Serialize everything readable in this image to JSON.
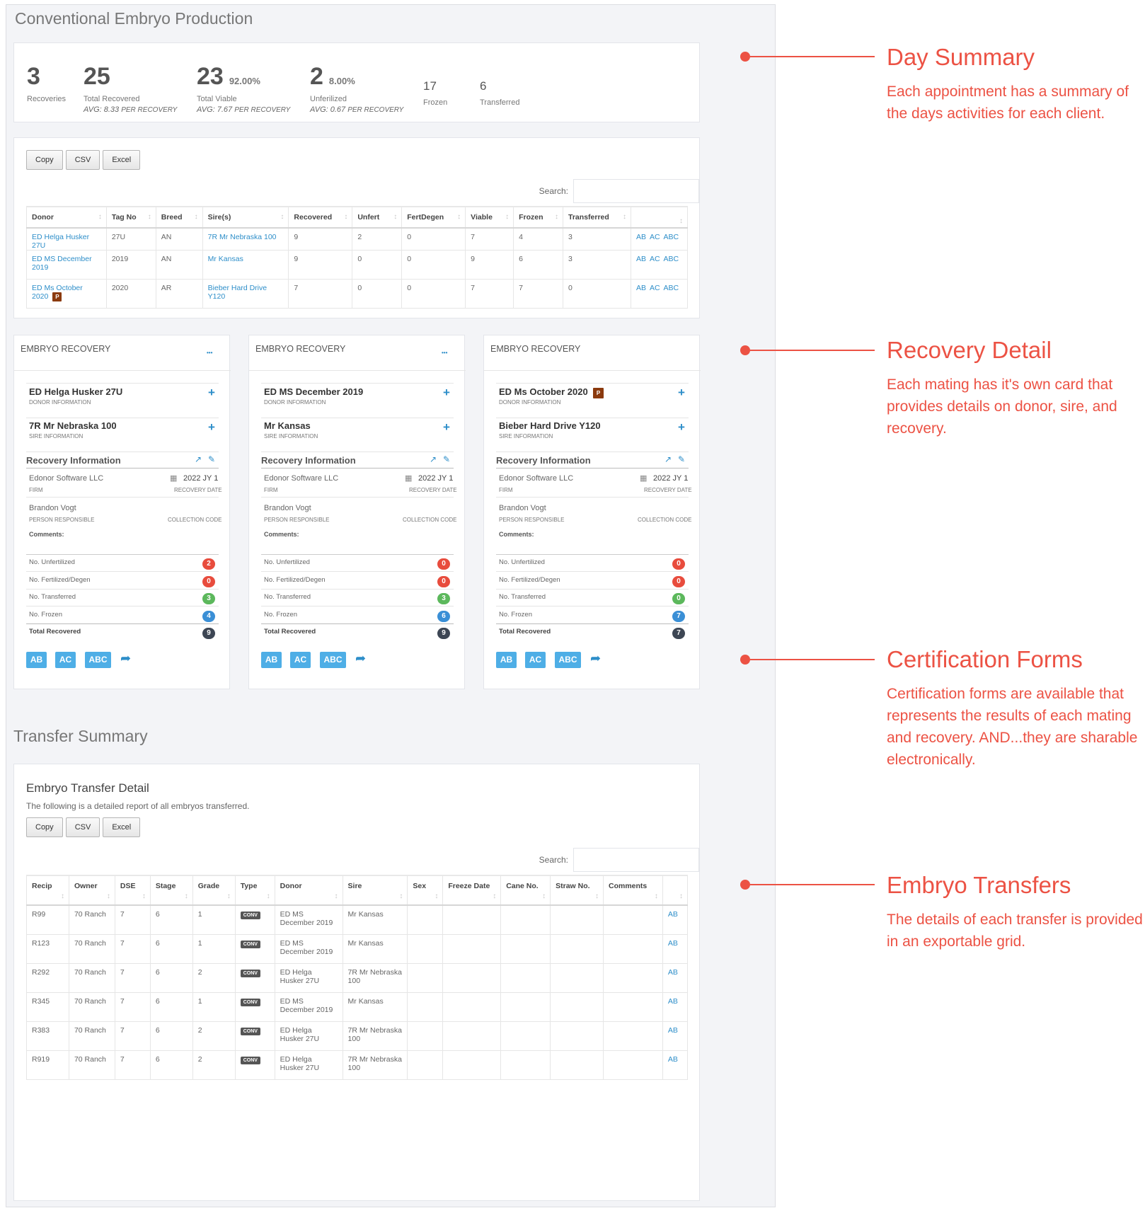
{
  "page_title": "Conventional Embryo Production",
  "summary": {
    "recoveries": {
      "value": "3",
      "label": "Recoveries"
    },
    "total_recovered": {
      "value": "25",
      "label": "Total Recovered",
      "avg": "AVG: 8.33",
      "avg_unit": "PER RECOVERY"
    },
    "total_viable": {
      "value": "23",
      "pct": "92.00%",
      "label": "Total Viable",
      "avg": "AVG: 7.67",
      "avg_unit": "PER RECOVERY"
    },
    "unfertilized": {
      "value": "2",
      "pct": "8.00%",
      "label": "Unferilized",
      "avg": "AVG: 0.67",
      "avg_unit": "PER RECOVERY"
    },
    "frozen": {
      "value": "17",
      "label": "Frozen"
    },
    "transferred": {
      "value": "6",
      "label": "Transferred"
    }
  },
  "export_buttons": {
    "copy": "Copy",
    "csv": "CSV",
    "excel": "Excel"
  },
  "search_label": "Search:",
  "donor_table": {
    "headers": [
      "Donor",
      "Tag No",
      "Breed",
      "Sire(s)",
      "Recovered",
      "Unfert",
      "FertDegen",
      "Viable",
      "Frozen",
      "Transferred",
      ""
    ],
    "rows": [
      {
        "donor": "ED Helga Husker 27U",
        "tag": "27U",
        "breed": "AN",
        "sire": "7R Mr Nebraska 100",
        "recovered": "9",
        "unfert": "2",
        "fertdegen": "0",
        "viable": "7",
        "frozen": "4",
        "transferred": "3",
        "certs": [
          "AB",
          "AC",
          "ABC"
        ],
        "flag": ""
      },
      {
        "donor": "ED MS December 2019",
        "tag": "2019",
        "breed": "AN",
        "sire": "Mr Kansas",
        "recovered": "9",
        "unfert": "0",
        "fertdegen": "0",
        "viable": "9",
        "frozen": "6",
        "transferred": "3",
        "certs": [
          "AB",
          "AC",
          "ABC"
        ],
        "flag": ""
      },
      {
        "donor": "ED Ms October 2020",
        "tag": "2020",
        "breed": "AR",
        "sire": "Bieber Hard Drive Y120",
        "recovered": "7",
        "unfert": "0",
        "fertdegen": "0",
        "viable": "7",
        "frozen": "7",
        "transferred": "0",
        "certs": [
          "AB",
          "AC",
          "ABC"
        ],
        "flag": "P"
      }
    ]
  },
  "recovery_cards": [
    {
      "header": "EMBRYO RECOVERY",
      "donor": "ED Helga Husker 27U",
      "donor_flag": "",
      "donor_sub": "DONOR INFORMATION",
      "sire": "7R Mr Nebraska 100",
      "sire_sub": "SIRE INFORMATION",
      "section": "Recovery Information",
      "firm": "Edonor Software LLC",
      "firm_label": "FIRM",
      "date": "2022 JY 1",
      "date_label": "RECOVERY DATE",
      "person": "Brandon Vogt",
      "person_label": "PERSON RESPONSIBLE",
      "code_label": "COLLECTION CODE",
      "comments_label": "Comments:",
      "stats": [
        {
          "label": "No. Unfertilized",
          "value": "2",
          "color": "#e84c3d"
        },
        {
          "label": "No. Fertilized/Degen",
          "value": "0",
          "color": "#e84c3d"
        },
        {
          "label": "No. Transferred",
          "value": "3",
          "color": "#5cb85c"
        },
        {
          "label": "No. Frozen",
          "value": "4",
          "color": "#3a8fd6"
        },
        {
          "label": "Total Recovered",
          "value": "9",
          "color": "#3d4654"
        }
      ],
      "certs": [
        "AB",
        "AC",
        "ABC"
      ],
      "has_menu": true
    },
    {
      "header": "EMBRYO RECOVERY",
      "donor": "ED MS December 2019",
      "donor_flag": "",
      "donor_sub": "DONOR INFORMATION",
      "sire": "Mr Kansas",
      "sire_sub": "SIRE INFORMATION",
      "section": "Recovery Information",
      "firm": "Edonor Software LLC",
      "firm_label": "FIRM",
      "date": "2022 JY 1",
      "date_label": "RECOVERY DATE",
      "person": "Brandon Vogt",
      "person_label": "PERSON RESPONSIBLE",
      "code_label": "COLLECTION CODE",
      "comments_label": "Comments:",
      "stats": [
        {
          "label": "No. Unfertilized",
          "value": "0",
          "color": "#e84c3d"
        },
        {
          "label": "No. Fertilized/Degen",
          "value": "0",
          "color": "#e84c3d"
        },
        {
          "label": "No. Transferred",
          "value": "3",
          "color": "#5cb85c"
        },
        {
          "label": "No. Frozen",
          "value": "6",
          "color": "#3a8fd6"
        },
        {
          "label": "Total Recovered",
          "value": "9",
          "color": "#3d4654"
        }
      ],
      "certs": [
        "AB",
        "AC",
        "ABC"
      ],
      "has_menu": true
    },
    {
      "header": "EMBRYO RECOVERY",
      "donor": "ED Ms October 2020",
      "donor_flag": "P",
      "donor_sub": "DONOR INFORMATION",
      "sire": "Bieber Hard Drive Y120",
      "sire_sub": "SIRE INFORMATION",
      "section": "Recovery Information",
      "firm": "Edonor Software LLC",
      "firm_label": "FIRM",
      "date": "2022 JY 1",
      "date_label": "RECOVERY DATE",
      "person": "Brandon Vogt",
      "person_label": "PERSON RESPONSIBLE",
      "code_label": "COLLECTION CODE",
      "comments_label": "Comments:",
      "stats": [
        {
          "label": "No. Unfertilized",
          "value": "0",
          "color": "#e84c3d"
        },
        {
          "label": "No. Fertilized/Degen",
          "value": "0",
          "color": "#e84c3d"
        },
        {
          "label": "No. Transferred",
          "value": "0",
          "color": "#5cb85c"
        },
        {
          "label": "No. Frozen",
          "value": "7",
          "color": "#3a8fd6"
        },
        {
          "label": "Total Recovered",
          "value": "7",
          "color": "#3d4654"
        }
      ],
      "certs": [
        "AB",
        "AC",
        "ABC"
      ],
      "has_menu": false
    }
  ],
  "transfer_section_title": "Transfer Summary",
  "transfer": {
    "title": "Embryo Transfer Detail",
    "desc": "The following is a detailed report of all embryos transferred.",
    "headers": [
      "Recip",
      "Owner",
      "DSE",
      "Stage",
      "Grade",
      "Type",
      "Donor",
      "Sire",
      "Sex",
      "Freeze Date",
      "Cane No.",
      "Straw No.",
      "Comments",
      ""
    ],
    "rows": [
      {
        "recip": "R99",
        "owner": "70 Ranch",
        "dse": "7",
        "stage": "6",
        "grade": "1",
        "type": "CONV",
        "donor": "ED MS December 2019",
        "sire": "Mr Kansas",
        "cert": "AB"
      },
      {
        "recip": "R123",
        "owner": "70 Ranch",
        "dse": "7",
        "stage": "6",
        "grade": "1",
        "type": "CONV",
        "donor": "ED MS December 2019",
        "sire": "Mr Kansas",
        "cert": "AB"
      },
      {
        "recip": "R292",
        "owner": "70 Ranch",
        "dse": "7",
        "stage": "6",
        "grade": "2",
        "type": "CONV",
        "donor": "ED Helga Husker 27U",
        "sire": "7R Mr Nebraska 100",
        "cert": "AB"
      },
      {
        "recip": "R345",
        "owner": "70 Ranch",
        "dse": "7",
        "stage": "6",
        "grade": "1",
        "type": "CONV",
        "donor": "ED MS December 2019",
        "sire": "Mr Kansas",
        "cert": "AB"
      },
      {
        "recip": "R383",
        "owner": "70 Ranch",
        "dse": "7",
        "stage": "6",
        "grade": "2",
        "type": "CONV",
        "donor": "ED Helga Husker 27U",
        "sire": "7R Mr Nebraska 100",
        "cert": "AB"
      },
      {
        "recip": "R919",
        "owner": "70 Ranch",
        "dse": "7",
        "stage": "6",
        "grade": "2",
        "type": "CONV",
        "donor": "ED Helga Husker 27U",
        "sire": "7R Mr Nebraska 100",
        "cert": "AB"
      }
    ]
  },
  "annotations": [
    {
      "title": "Day Summary",
      "desc": "Each appointment has a summary of the days activities for each client."
    },
    {
      "title": "Recovery Detail",
      "desc": "Each mating has it's own card that provides details on donor, sire, and recovery."
    },
    {
      "title": "Certification Forms",
      "desc": "Certification forms are available that represents the results of each mating and recovery. AND...they are sharable electronically."
    },
    {
      "title": "Embryo Transfers",
      "desc": "The details of each transfer is provided in an exportable grid."
    }
  ],
  "colors": {
    "accent": "#ec5244",
    "link": "#2d8ec9",
    "cert_button": "#4eaee6"
  },
  "icons": {
    "menu": "ellipsis-icon",
    "expand": "plus-icon",
    "open": "external-link-icon",
    "edit": "edit-icon",
    "calendar": "calendar-icon",
    "share": "share-icon",
    "sort": "sort-icon"
  }
}
